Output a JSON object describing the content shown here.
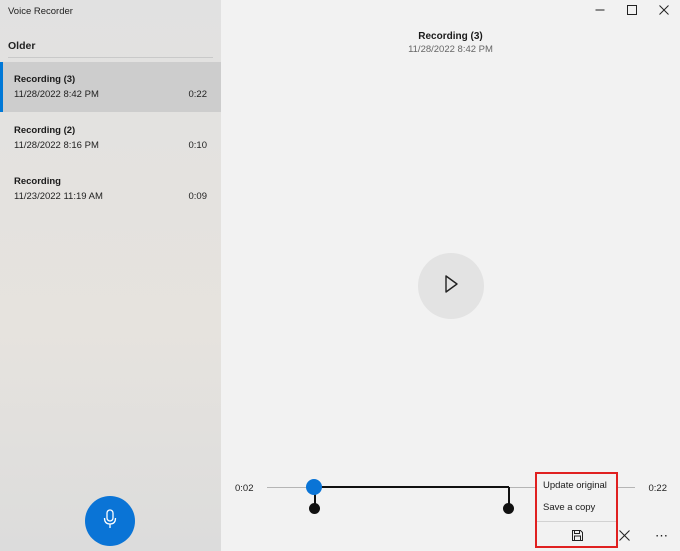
{
  "app": {
    "title": "Voice Recorder"
  },
  "sidebar": {
    "section_header": "Older",
    "recordings": [
      {
        "name": "Recording (3)",
        "date": "11/28/2022 8:42 PM",
        "duration": "0:22",
        "selected": true
      },
      {
        "name": "Recording (2)",
        "date": "11/28/2022 8:16 PM",
        "duration": "0:10",
        "selected": false
      },
      {
        "name": "Recording",
        "date": "11/23/2022 11:19 AM",
        "duration": "0:09",
        "selected": false
      }
    ],
    "record_button_icon": "microphone-icon"
  },
  "main": {
    "title": "Recording (3)",
    "date": "11/28/2022 8:42 PM",
    "play_icon": "play-icon",
    "trim": {
      "time_start": "0:02",
      "time_end": "0:22"
    },
    "save_menu": {
      "options": [
        "Update original",
        "Save a copy"
      ],
      "save_icon": "save-icon"
    },
    "close_icon": "close-icon",
    "more_icon": "more-icon",
    "more_label": "⋯"
  },
  "window_controls": [
    "minimize-icon",
    "maximize-icon",
    "close-icon"
  ],
  "colors": {
    "accent": "#0078d7",
    "highlight_border": "#e02020"
  }
}
